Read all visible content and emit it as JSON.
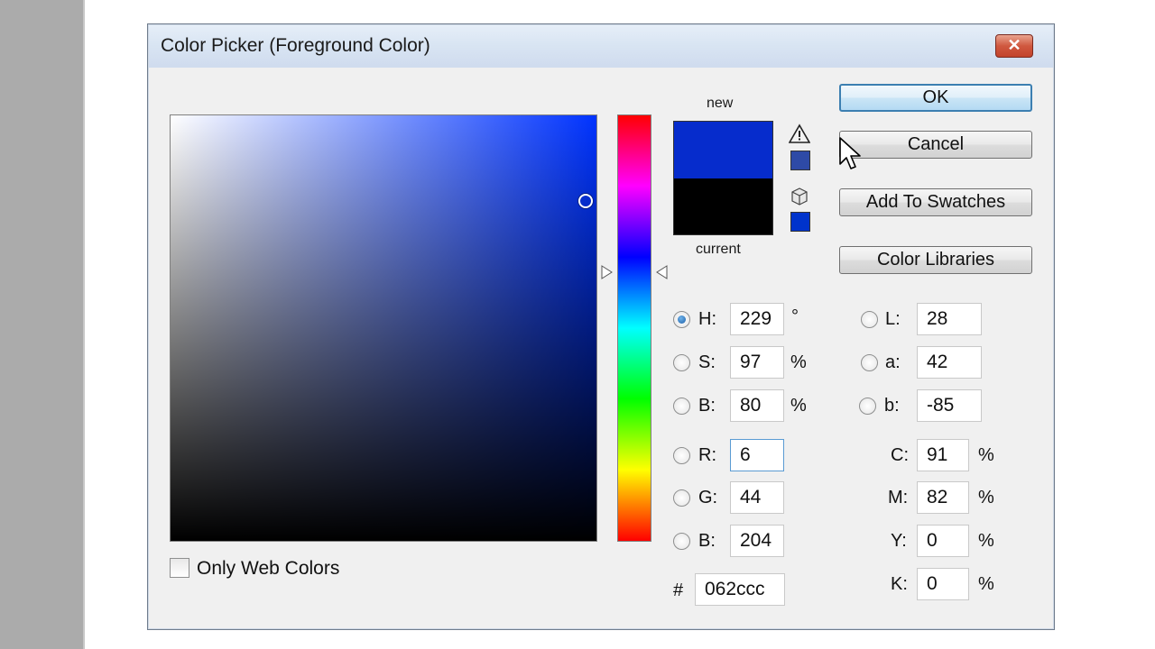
{
  "window": {
    "title": "Color Picker (Foreground Color)",
    "close_symbol": "✕"
  },
  "preview": {
    "new_label": "new",
    "current_label": "current",
    "new_color": "#062ccc",
    "current_color": "#000000",
    "gamut_swatch_color": "#2e4aa6",
    "web_swatch_color": "#0033cc"
  },
  "buttons": {
    "ok": "OK",
    "cancel": "Cancel",
    "add_to_swatches": "Add To Swatches",
    "color_libraries": "Color Libraries"
  },
  "hsb": {
    "h": {
      "label": "H:",
      "value": "229",
      "unit": "°",
      "selected": true
    },
    "s": {
      "label": "S:",
      "value": "97",
      "unit": "%"
    },
    "b": {
      "label": "B:",
      "value": "80",
      "unit": "%"
    }
  },
  "rgb": {
    "r": {
      "label": "R:",
      "value": "6"
    },
    "g": {
      "label": "G:",
      "value": "44"
    },
    "b": {
      "label": "B:",
      "value": "204"
    }
  },
  "lab": {
    "l": {
      "label": "L:",
      "value": "28"
    },
    "a": {
      "label": "a:",
      "value": "42"
    },
    "b": {
      "label": "b:",
      "value": "-85"
    }
  },
  "cmyk": {
    "c": {
      "label": "C:",
      "value": "91",
      "unit": "%"
    },
    "m": {
      "label": "M:",
      "value": "82",
      "unit": "%"
    },
    "y": {
      "label": "Y:",
      "value": "0",
      "unit": "%"
    },
    "k": {
      "label": "K:",
      "value": "0",
      "unit": "%"
    }
  },
  "hex": {
    "label": "#",
    "value": "062ccc"
  },
  "only_web_colors": {
    "label": "Only Web Colors",
    "checked": false
  },
  "field": {
    "hue_color": "#0033ff",
    "saturation_pct": 97,
    "brightness_pct": 80
  },
  "hue_slider": {
    "hue_deg": 229
  },
  "icons": {
    "gamut_warning": "warning-triangle-icon",
    "web_safe": "cube-icon",
    "cursor": "mouse-pointer-icon"
  }
}
